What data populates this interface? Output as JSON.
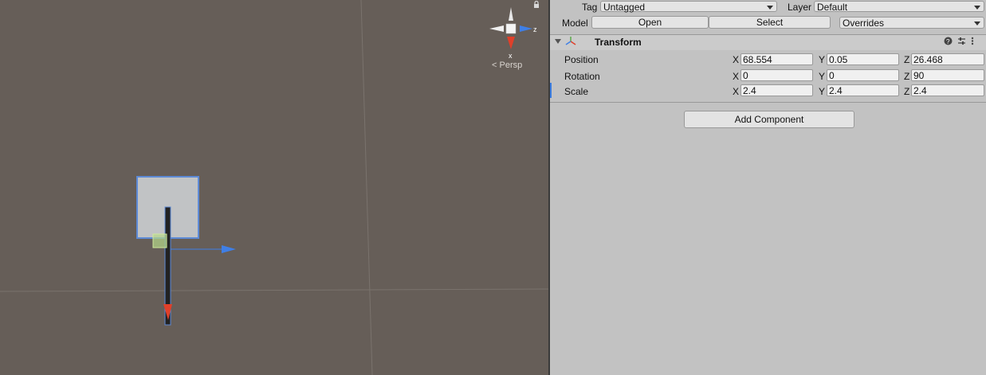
{
  "scene": {
    "gizmo": {
      "x_label": "x",
      "z_label": "z"
    },
    "projection_label": "Persp"
  },
  "inspector": {
    "tag_label": "Tag",
    "tag_value": "Untagged",
    "layer_label": "Layer",
    "layer_value": "Default",
    "model_label": "Model",
    "open_label": "Open",
    "select_label": "Select",
    "overrides_label": "Overrides",
    "transform": {
      "title": "Transform",
      "position": {
        "label": "Position",
        "x": "68.554",
        "y": "0.05",
        "z": "26.468"
      },
      "rotation": {
        "label": "Rotation",
        "x": "0",
        "y": "0",
        "z": "90"
      },
      "scale": {
        "label": "Scale",
        "x": "2.4",
        "y": "2.4",
        "z": "2.4"
      },
      "axis_x": "X",
      "axis_y": "Y",
      "axis_z": "Z"
    },
    "add_component_label": "Add Component"
  },
  "colors": {
    "scene_bg": "#665e58",
    "inspector_bg": "#c2c2c2",
    "x_axis": "#e0402a",
    "z_axis": "#3f7fe6",
    "selection_outline": "#5d8ad6"
  }
}
